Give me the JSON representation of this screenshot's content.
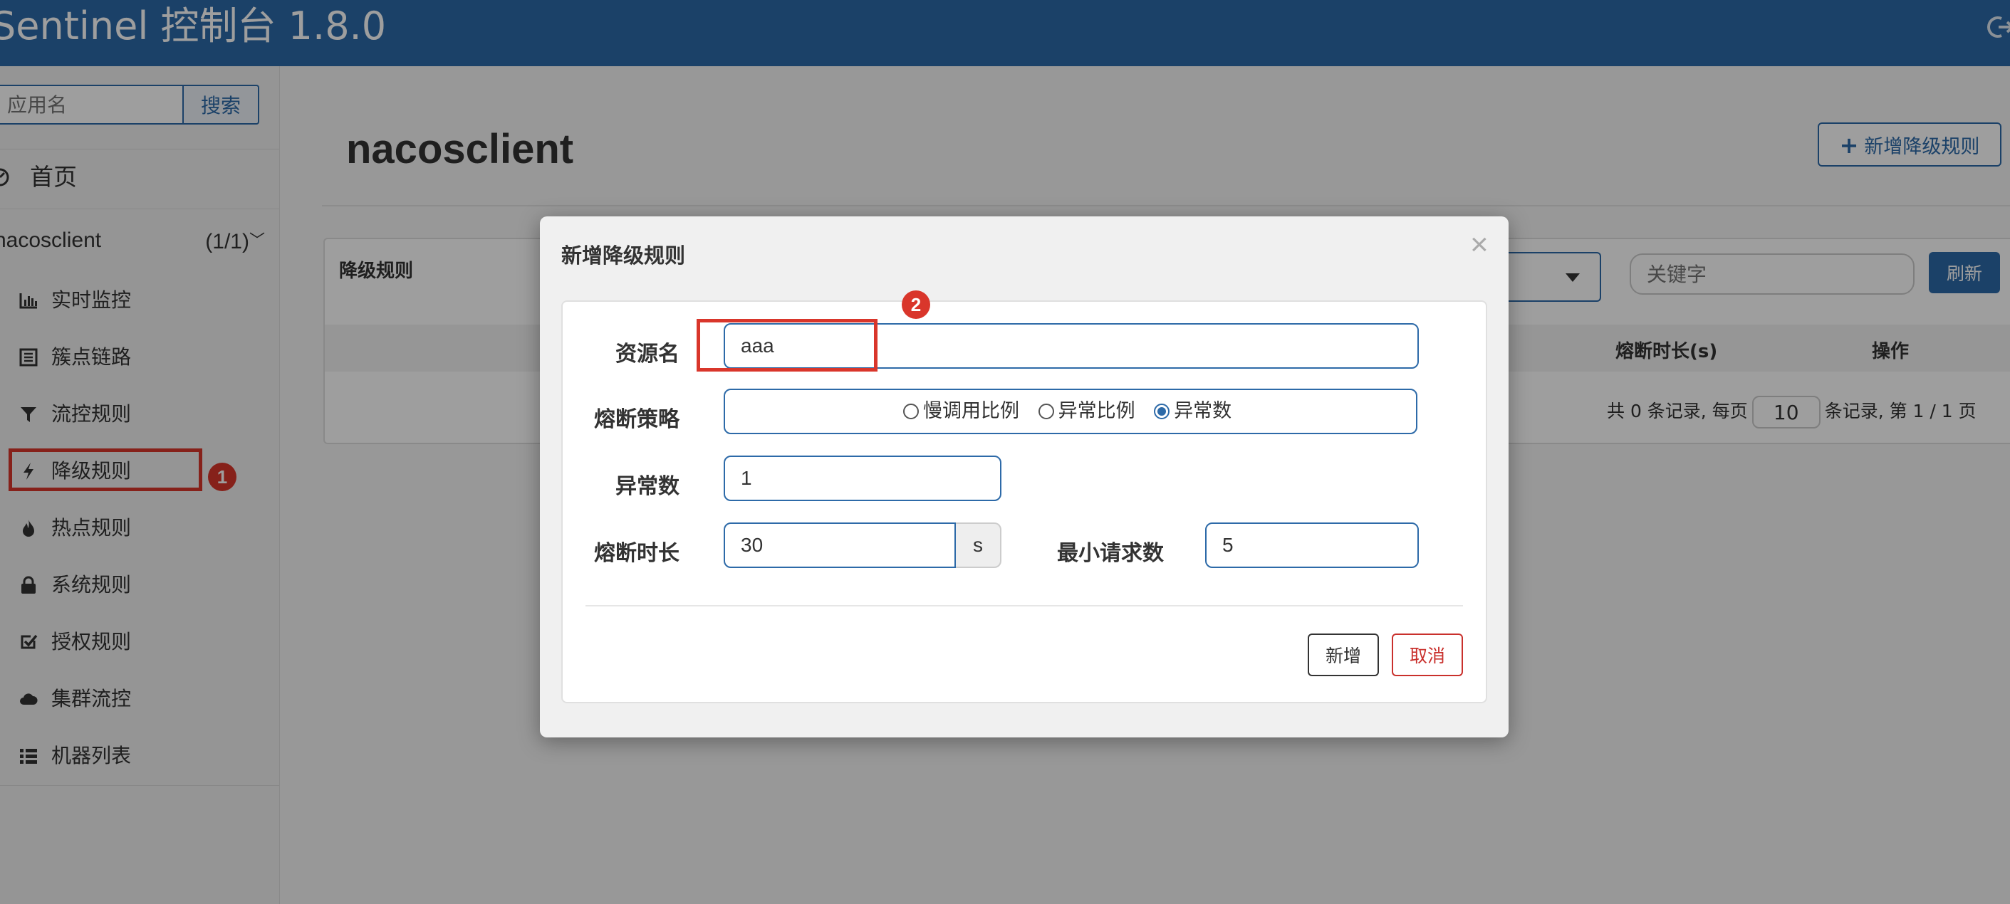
{
  "header": {
    "title": "Sentinel 控制台 1.8.0"
  },
  "sidebar": {
    "search_placeholder": "应用名",
    "search_button": "搜索",
    "home": "首页",
    "app": {
      "name": "nacosclient",
      "count": "(1/1)"
    },
    "items": [
      {
        "label": "实时监控",
        "icon": "bar-chart-icon"
      },
      {
        "label": "簇点链路",
        "icon": "list-alt-icon"
      },
      {
        "label": "流控规则",
        "icon": "filter-icon"
      },
      {
        "label": "降级规则",
        "icon": "lightning-icon"
      },
      {
        "label": "热点规则",
        "icon": "fire-icon"
      },
      {
        "label": "系统规则",
        "icon": "lock-icon"
      },
      {
        "label": "授权规则",
        "icon": "check-icon"
      },
      {
        "label": "集群流控",
        "icon": "cloud-icon"
      },
      {
        "label": "机器列表",
        "icon": "list-icon"
      }
    ]
  },
  "main": {
    "title": "nacosclient",
    "add_button": "新增降级规则",
    "panel_title": "降级规则",
    "keyword_placeholder": "关键字",
    "refresh": "刷新",
    "columns": {
      "duration": "熔断时长(s)",
      "ops": "操作"
    },
    "pager": {
      "prefix": "共 0 条记录, 每页",
      "size": "10",
      "suffix": "条记录, 第 1 / 1 页"
    }
  },
  "modal": {
    "title": "新增降级规则",
    "close": "×",
    "resource_label": "资源名",
    "resource_value": "aaa",
    "strategy_label": "熔断策略",
    "strategies": [
      "慢调用比例",
      "异常比例",
      "异常数"
    ],
    "selected_strategy": "异常数",
    "count_label": "异常数",
    "count_value": "1",
    "duration_label": "熔断时长",
    "duration_value": "30",
    "duration_unit": "s",
    "min_req_label": "最小请求数",
    "min_req_value": "5",
    "submit": "新增",
    "cancel": "取消"
  },
  "annotations": {
    "badge1": "1",
    "badge2": "2"
  },
  "colors": {
    "primary": "#2d6aa8",
    "annotation_red": "#d9362b",
    "danger": "#c9302c"
  }
}
